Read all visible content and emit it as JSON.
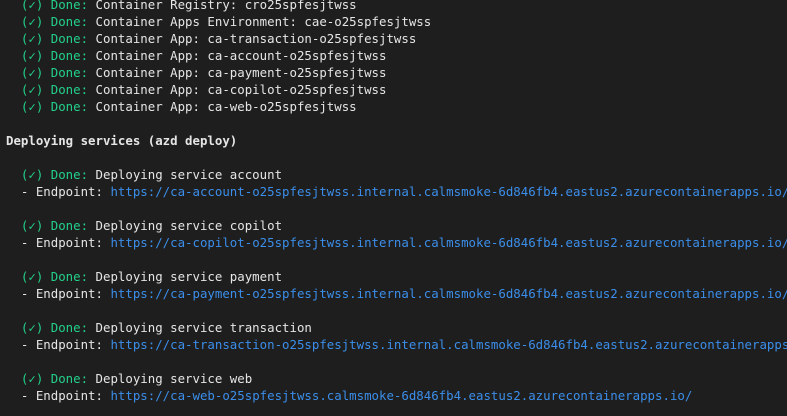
{
  "provision_lines": [
    {
      "done": "(✓) Done:",
      "text": "Container Registry: cro25spfesjtwss"
    },
    {
      "done": "(✓) Done:",
      "text": "Container Apps Environment: cae-o25spfesjtwss"
    },
    {
      "done": "(✓) Done:",
      "text": "Container App: ca-transaction-o25spfesjtwss"
    },
    {
      "done": "(✓) Done:",
      "text": "Container App: ca-account-o25spfesjtwss"
    },
    {
      "done": "(✓) Done:",
      "text": "Container App: ca-payment-o25spfesjtwss"
    },
    {
      "done": "(✓) Done:",
      "text": "Container App: ca-copilot-o25spfesjtwss"
    },
    {
      "done": "(✓) Done:",
      "text": "Container App: ca-web-o25spfesjtwss"
    }
  ],
  "deploy_heading": "Deploying services (azd deploy)",
  "deployments": [
    {
      "done": "(✓) Done:",
      "text": "Deploying service account",
      "endpoint_label": "- Endpoint:",
      "endpoint_url": "https://ca-account-o25spfesjtwss.internal.calmsmoke-6d846fb4.eastus2.azurecontainerapps.io/"
    },
    {
      "done": "(✓) Done:",
      "text": "Deploying service copilot",
      "endpoint_label": "- Endpoint:",
      "endpoint_url": "https://ca-copilot-o25spfesjtwss.internal.calmsmoke-6d846fb4.eastus2.azurecontainerapps.io/"
    },
    {
      "done": "(✓) Done:",
      "text": "Deploying service payment",
      "endpoint_label": "- Endpoint:",
      "endpoint_url": "https://ca-payment-o25spfesjtwss.internal.calmsmoke-6d846fb4.eastus2.azurecontainerapps.io/"
    },
    {
      "done": "(✓) Done:",
      "text": "Deploying service transaction",
      "endpoint_label": "- Endpoint:",
      "endpoint_url": "https://ca-transaction-o25spfesjtwss.internal.calmsmoke-6d846fb4.eastus2.azurecontainerapps.io/"
    },
    {
      "done": "(✓) Done:",
      "text": "Deploying service web",
      "endpoint_label": "- Endpoint:",
      "endpoint_url": "https://ca-web-o25spfesjtwss.calmsmoke-6d846fb4.eastus2.azurecontainerapps.io/"
    }
  ]
}
